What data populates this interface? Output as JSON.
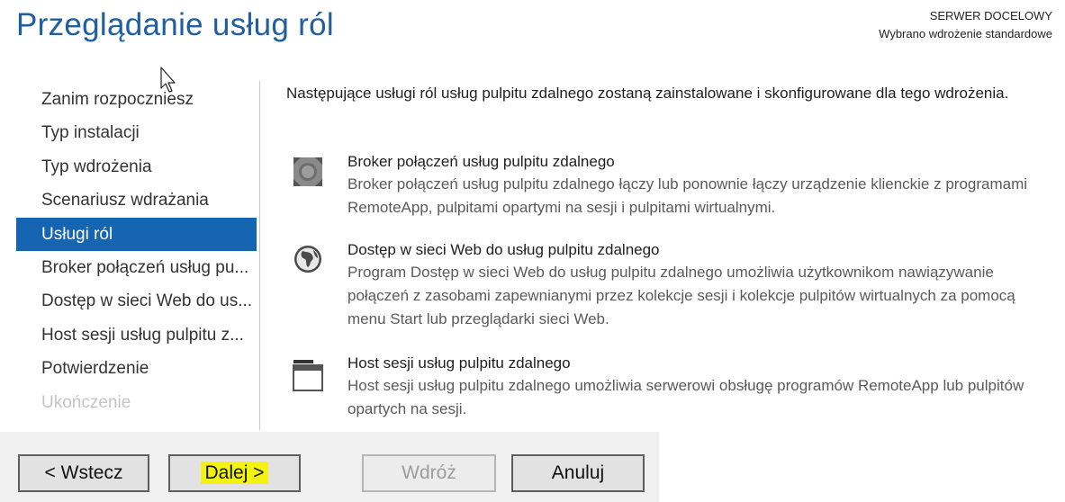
{
  "header": {
    "title": "Przeglądanie usług ról",
    "dest_label": "SERWER DOCELOWY",
    "dest_value": "Wybrano wdrożenie standardowe"
  },
  "nav": {
    "items": [
      {
        "label": "Zanim rozpoczniesz"
      },
      {
        "label": "Typ instalacji"
      },
      {
        "label": "Typ wdrożenia"
      },
      {
        "label": "Scenariusz wdrażania"
      },
      {
        "label": "Usługi ról"
      },
      {
        "label": "Broker połączeń usług pu..."
      },
      {
        "label": "Dostęp w sieci Web do us..."
      },
      {
        "label": "Host sesji usług pulpitu z..."
      },
      {
        "label": "Potwierdzenie"
      },
      {
        "label": "Ukończenie"
      }
    ]
  },
  "content": {
    "intro": "Następujące usługi ról usług pulpitu zdalnego zostaną zainstalowane i skonfigurowane dla tego wdrożenia.",
    "services": [
      {
        "icon": "broker-icon",
        "title": "Broker połączeń usług pulpitu zdalnego",
        "description": "Broker połączeń usług pulpitu zdalnego łączy lub ponownie łączy urządzenie klienckie z programami RemoteApp, pulpitami opartymi na sesji i pulpitami wirtualnymi."
      },
      {
        "icon": "globe-icon",
        "title": "Dostęp w sieci Web do usług pulpitu zdalnego",
        "description": "Program Dostęp w sieci Web do usług pulpitu zdalnego umożliwia użytkownikom nawiązywanie połączeń z zasobami zapewnianymi przez kolekcje sesji i kolekcje pulpitów wirtualnych za pomocą menu Start lub przeglądarki sieci Web."
      },
      {
        "icon": "session-host-icon",
        "title": "Host sesji usług pulpitu zdalnego",
        "description": "Host sesji usług pulpitu zdalnego umożliwia serwerowi obsługę programów RemoteApp lub pulpitów opartych na sesji."
      }
    ]
  },
  "buttons": {
    "back": "< Wstecz",
    "next": "Dalej >",
    "deploy": "Wdróż",
    "cancel": "Anuluj"
  },
  "colors": {
    "title": "#1f5fa0",
    "nav_active": "#1565b2",
    "highlight": "#f3f311"
  }
}
